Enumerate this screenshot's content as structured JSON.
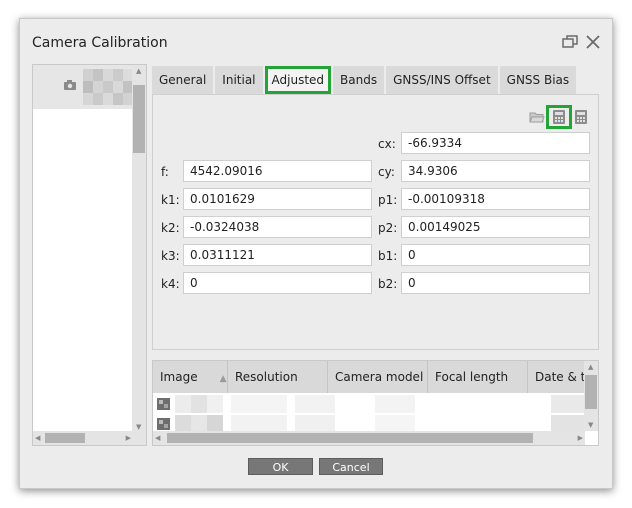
{
  "dialog": {
    "title": "Camera Calibration"
  },
  "tabs": [
    {
      "label": "General"
    },
    {
      "label": "Initial"
    },
    {
      "label": "Adjusted"
    },
    {
      "label": "Bands"
    },
    {
      "label": "GNSS/INS Offset"
    },
    {
      "label": "GNSS Bias"
    }
  ],
  "active_tab": "Adjusted",
  "params": {
    "cx": {
      "label": "cx:",
      "value": "-66.9334"
    },
    "f": {
      "label": "f:",
      "value": "4542.09016"
    },
    "cy": {
      "label": "cy:",
      "value": "34.9306"
    },
    "k1": {
      "label": "k1:",
      "value": "0.0101629"
    },
    "p1": {
      "label": "p1:",
      "value": "-0.00109318"
    },
    "k2": {
      "label": "k2:",
      "value": "-0.0324038"
    },
    "p2": {
      "label": "p2:",
      "value": "0.00149025"
    },
    "k3": {
      "label": "k3:",
      "value": "0.0311121"
    },
    "b1": {
      "label": "b1:",
      "value": "0"
    },
    "k4": {
      "label": "k4:",
      "value": "0"
    },
    "b2": {
      "label": "b2:",
      "value": "0"
    }
  },
  "table": {
    "columns": [
      "Image",
      "Resolution",
      "Camera model",
      "Focal length",
      "Date & tim"
    ],
    "sorted_column": "Image"
  },
  "buttons": {
    "ok": "OK",
    "cancel": "Cancel"
  },
  "colors": {
    "highlight": "#24a336",
    "button": "#777777"
  }
}
